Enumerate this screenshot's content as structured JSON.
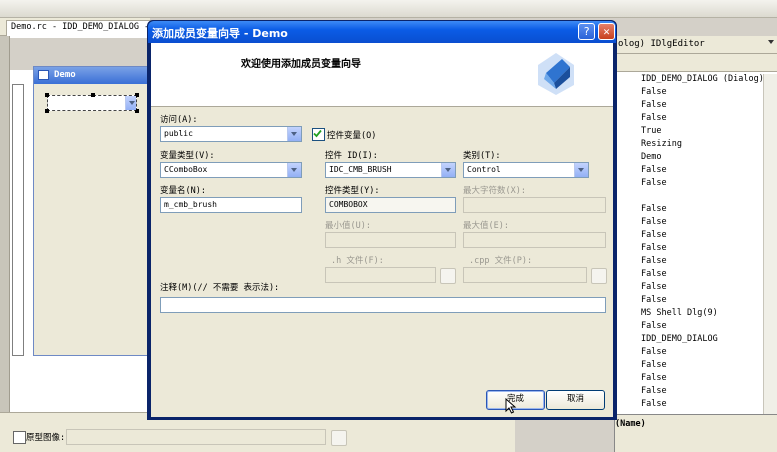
{
  "ide": {
    "doc_tab": "Demo.rc - IDD_DEMO_DIALOG - D",
    "form_title": "Demo",
    "bottom_checkbox_label": "原型图像:",
    "properties_header": "olog) IDlgEditor",
    "property_values": [
      "IDD_DEMO_DIALOG (Dialog)",
      "False",
      "False",
      "False",
      "True",
      "Resizing",
      "Demo",
      "False",
      "False",
      "",
      "False",
      "False",
      "False",
      "False",
      "False",
      "False",
      "False",
      "False",
      "MS Shell Dlg(9)",
      "False",
      "IDD_DEMO_DIALOG",
      "False",
      "False",
      "False",
      "False",
      "False"
    ],
    "description_label": "(Name)"
  },
  "dialog": {
    "title": "添加成员变量向导 - Demo",
    "help_glyph": "?",
    "close_glyph": "✕",
    "heading": "欢迎使用添加成员变量向导",
    "access": {
      "label": "访问(A):",
      "value": "public"
    },
    "control_var": {
      "label": "控件变量(O)",
      "checked": true
    },
    "var_type": {
      "label": "变量类型(V):",
      "value": "CComboBox"
    },
    "control_id": {
      "label": "控件 ID(I):",
      "value": "IDC_CMB_BRUSH"
    },
    "category": {
      "label": "类别(T):",
      "value": "Control"
    },
    "var_name": {
      "label": "变量名(N):",
      "value": "m_cmb_brush"
    },
    "control_type": {
      "label": "控件类型(Y):",
      "value": "COMBOBOX"
    },
    "max_chars": {
      "label": "最大字符数(X):",
      "value": ""
    },
    "min_value": {
      "label": "最小值(U):",
      "value": ""
    },
    "max_value": {
      "label": "最大值(E):",
      "value": ""
    },
    "h_file": {
      "label": ".h 文件(F):",
      "value": ""
    },
    "cpp_file": {
      "label": ".cpp 文件(P):",
      "value": ""
    },
    "comment": {
      "label": "注释(M)(// 不需要 表示法):",
      "value": ""
    },
    "finish_label": "完成",
    "cancel_label": "取消"
  }
}
